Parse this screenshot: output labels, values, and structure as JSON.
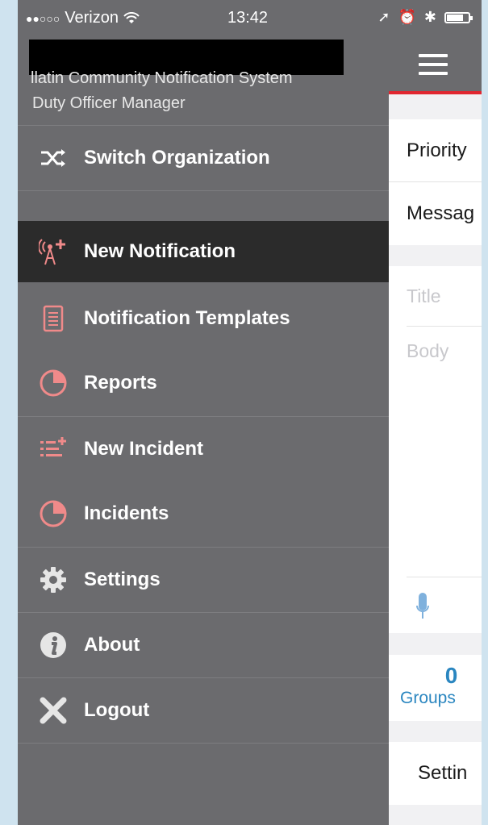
{
  "status_bar": {
    "carrier": "Verizon",
    "time": "13:42"
  },
  "drawer": {
    "organization": "llatin Community Notification System",
    "role": "Duty Officer Manager",
    "items": [
      {
        "label": "Switch Organization",
        "icon": "shuffle-icon"
      },
      {
        "label": "New Notification",
        "icon": "broadcast-tower-icon",
        "active": true
      },
      {
        "label": "Notification Templates",
        "icon": "document-icon"
      },
      {
        "label": "Reports",
        "icon": "pie-chart-icon"
      },
      {
        "label": "New Incident",
        "icon": "add-list-icon"
      },
      {
        "label": "Incidents",
        "icon": "pie-chart-icon"
      },
      {
        "label": "Settings",
        "icon": "gear-icon"
      },
      {
        "label": "About",
        "icon": "info-icon"
      },
      {
        "label": "Logout",
        "icon": "close-icon"
      }
    ]
  },
  "app": {
    "priority_label": "Priority",
    "message_label": "Messag",
    "title_placeholder": "Title",
    "body_placeholder": "Body",
    "groups_count": "0",
    "groups_label": "Groups",
    "settings_label": "Settin"
  },
  "colors": {
    "drawer_bg": "#6b6b6e",
    "active_bg": "#2b2b2b",
    "accent_red": "#e0262f",
    "icon_pink": "#f08a8a",
    "link_blue": "#2a86c0"
  }
}
